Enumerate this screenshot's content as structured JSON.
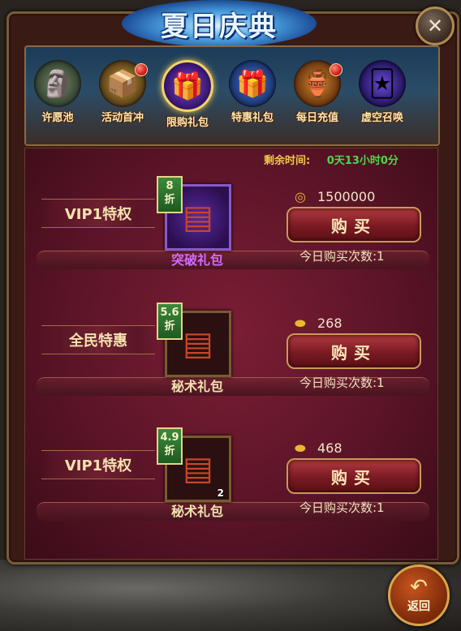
{
  "title": "夏日庆典",
  "close_label": "✕",
  "tabs": [
    {
      "label": "许愿池",
      "icon": "wishing-statue-icon",
      "glyph": "🗿",
      "badge": false,
      "active": false
    },
    {
      "label": "活动首冲",
      "icon": "treasure-chest-icon",
      "glyph": "📦",
      "badge": true,
      "active": false
    },
    {
      "label": "限购礼包",
      "icon": "purple-gift-box-icon",
      "glyph": "🎁",
      "badge": false,
      "active": true
    },
    {
      "label": "特惠礼包",
      "icon": "blue-gift-box-icon",
      "glyph": "🎁",
      "badge": false,
      "active": false
    },
    {
      "label": "每日充值",
      "icon": "gold-pot-icon",
      "glyph": "🏺",
      "badge": true,
      "active": false
    },
    {
      "label": "虚空召唤",
      "icon": "summon-cards-icon",
      "glyph": "🃏",
      "badge": false,
      "active": false
    }
  ],
  "timer": {
    "label": "剩余时间:",
    "value": "0天13小时0分"
  },
  "offers": [
    {
      "tag": "VIP1特权",
      "discount_num": "8",
      "discount_unit": "折",
      "item_name": "突破礼包",
      "item_count": "",
      "price_icon": "coin-icon",
      "price_glyph": "◎",
      "price": "1500000",
      "buy_label": "购买",
      "buy_count": "今日购买次数:1"
    },
    {
      "tag": "全民特惠",
      "discount_num": "5.6",
      "discount_unit": "折",
      "item_name": "秘术礼包",
      "item_count": "",
      "price_icon": "gold-ingot-icon",
      "price_glyph": "⬬",
      "price": "268",
      "buy_label": "购买",
      "buy_count": "今日购买次数:1"
    },
    {
      "tag": "VIP1特权",
      "discount_num": "4.9",
      "discount_unit": "折",
      "item_name": "秘术礼包",
      "item_count": "2",
      "price_icon": "gold-ingot-icon",
      "price_glyph": "⬬",
      "price": "468",
      "buy_label": "购买",
      "buy_count": "今日购买次数:1"
    }
  ],
  "back_label": "返回",
  "back_icon": "↶",
  "colors": {
    "accent_gold": "#f0c84a",
    "timer_green": "#4cd84c",
    "purple_item": "#cf6bff"
  }
}
